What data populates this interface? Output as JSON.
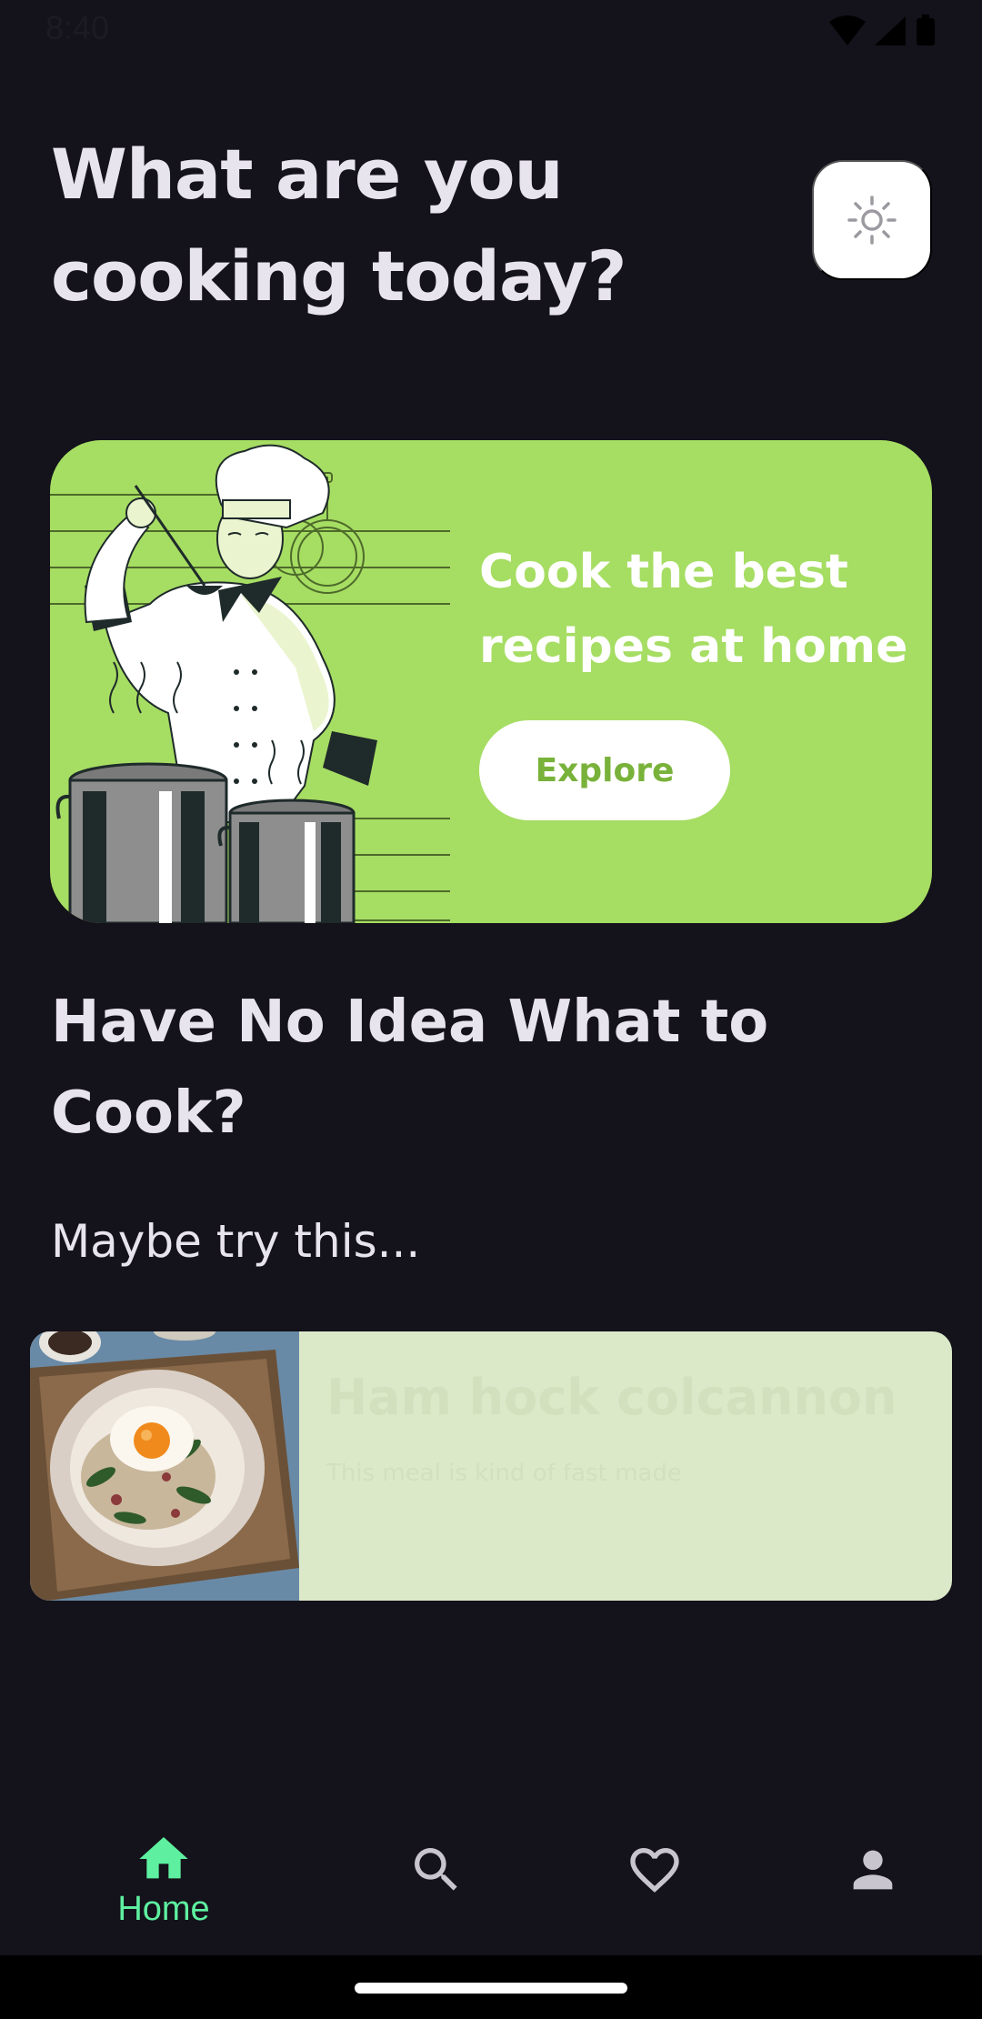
{
  "status_bar": {
    "time": "8:40",
    "icons": [
      "wifi-icon",
      "signal-icon",
      "battery-icon"
    ]
  },
  "header": {
    "title": "What are you cooking today?",
    "theme_toggle_icon": "sun-icon"
  },
  "banner": {
    "title": "Cook the best recipes at home",
    "button_label": "Explore",
    "background_color": "#a6dd63",
    "button_text_color": "#79b23a"
  },
  "suggestion": {
    "title": "Have No Idea What to Cook?",
    "subtitle": "Maybe try this..."
  },
  "recipe_card": {
    "title": "Ham hock colcannon",
    "description": "This meal is kind of fast made",
    "background_color": "#dbe9c9"
  },
  "bottom_nav": {
    "items": [
      {
        "label": "Home",
        "icon": "home-icon",
        "active": true
      },
      {
        "label": "",
        "icon": "search-icon",
        "active": false
      },
      {
        "label": "",
        "icon": "heart-icon",
        "active": false
      },
      {
        "label": "",
        "icon": "profile-icon",
        "active": false
      }
    ],
    "active_color": "#5ef0a0",
    "inactive_color": "#c9c5cf"
  },
  "colors": {
    "background": "#14121a",
    "text_primary": "#e8e4ee"
  }
}
